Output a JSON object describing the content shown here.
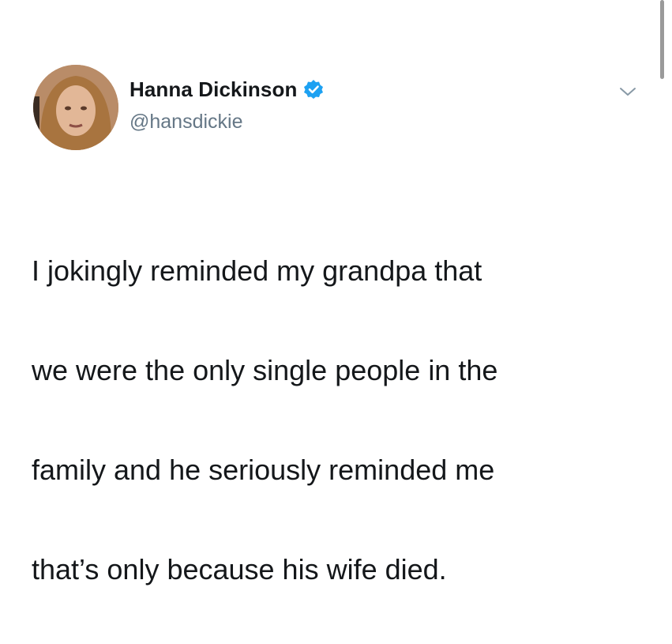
{
  "tweet": {
    "author": {
      "display_name": "Hanna Dickinson",
      "handle": "@hansdickie",
      "verified": true,
      "avatar_icon": "user-avatar-photo"
    },
    "menu_icon": "chevron-down-icon",
    "text_lines": [
      "I jokingly reminded my grandpa that",
      "we were the only single people in the",
      "family and he seriously reminded me",
      "that’s only because his wife died."
    ]
  },
  "colors": {
    "verified_badge": "#1da1f2",
    "handle": "#657786",
    "text": "#14171a",
    "background": "#ffffff"
  }
}
